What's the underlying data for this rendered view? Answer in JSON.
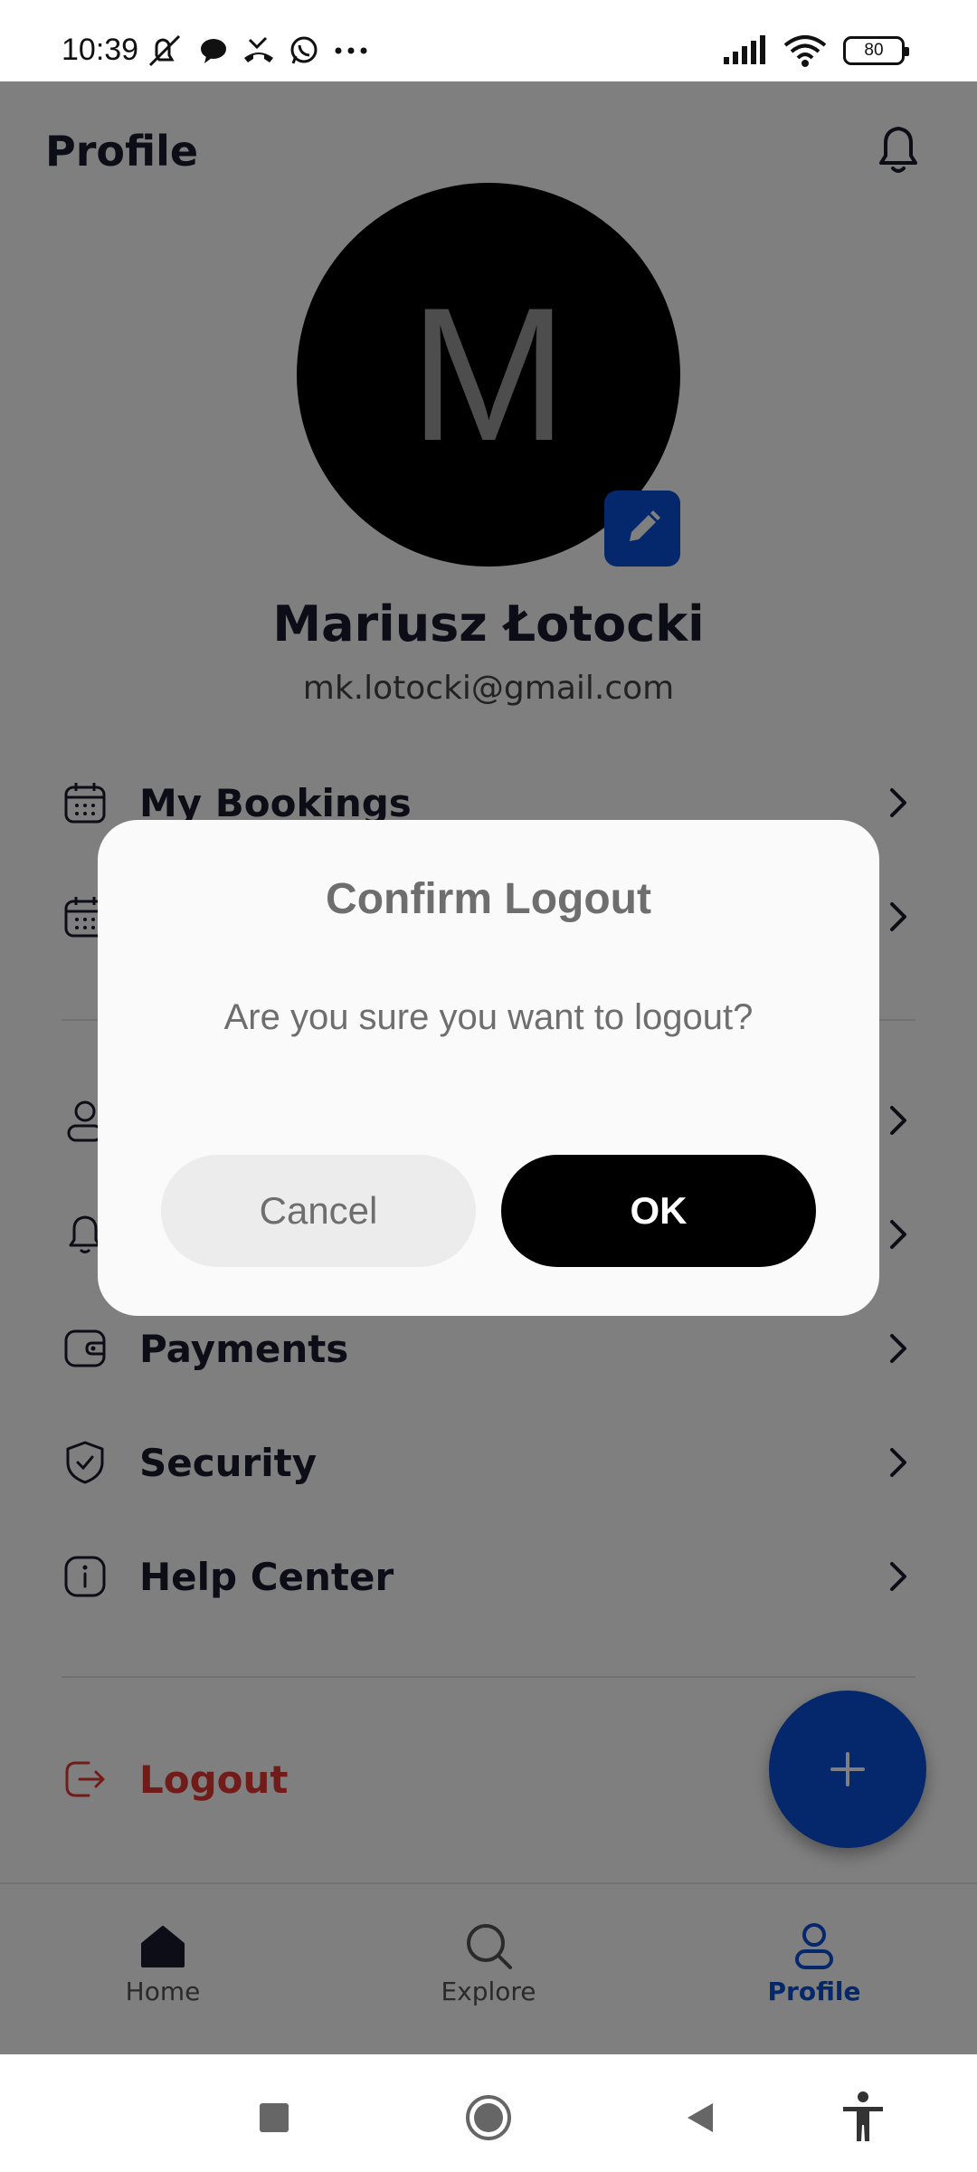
{
  "status_bar": {
    "time": "10:39",
    "battery": "80",
    "icons": [
      "mute-icon",
      "chat-bubble-icon",
      "missed-call-icon",
      "whatsapp-icon",
      "more-dots-icon",
      "signal-icon",
      "wifi-icon",
      "battery-icon"
    ]
  },
  "header": {
    "title": "Profile",
    "icon": "bell-icon"
  },
  "profile": {
    "initial": "M",
    "name": "Mariusz Łotocki",
    "email": "mk.lotocki@gmail.com"
  },
  "menu": {
    "items": [
      {
        "label": "My Bookings",
        "icon": "calendar-icon"
      },
      {
        "label": "",
        "icon": "calendar-icon"
      },
      {
        "label": "",
        "icon": "person-icon"
      },
      {
        "label": "",
        "icon": "bell-icon"
      },
      {
        "label": "Payments",
        "icon": "wallet-icon"
      },
      {
        "label": "Security",
        "icon": "shield-icon"
      },
      {
        "label": "Help Center",
        "icon": "info-icon"
      }
    ],
    "logout_label": "Logout"
  },
  "fab": {
    "icon": "plus-icon"
  },
  "bottom_nav": {
    "items": [
      {
        "label": "Home",
        "icon": "home-icon",
        "active": false
      },
      {
        "label": "Explore",
        "icon": "search-icon",
        "active": false
      },
      {
        "label": "Profile",
        "icon": "person-icon",
        "active": true
      }
    ]
  },
  "dialog": {
    "title": "Confirm Logout",
    "message": "Are you sure you want to logout?",
    "cancel_label": "Cancel",
    "ok_label": "OK"
  },
  "colors": {
    "accent": "#0b4fd6",
    "logout": "#e53935",
    "ok_button": "#000000",
    "cancel_button": "#ececec"
  }
}
